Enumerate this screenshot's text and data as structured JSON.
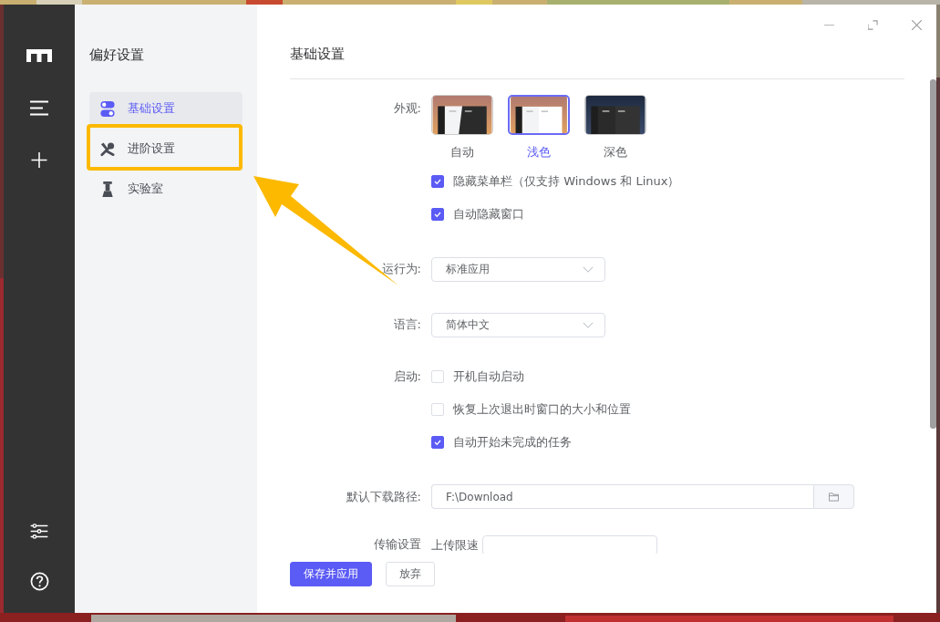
{
  "preferences": {
    "title": "偏好设置",
    "items": [
      {
        "label": "基础设置",
        "selected": true
      },
      {
        "label": "进阶设置",
        "selected": false
      },
      {
        "label": "实验室",
        "selected": false
      }
    ]
  },
  "page_title": "基础设置",
  "appearance": {
    "label": "外观:",
    "themes": [
      {
        "label": "自动",
        "kind": "auto",
        "selected": false
      },
      {
        "label": "浅色",
        "kind": "light",
        "selected": true
      },
      {
        "label": "深色",
        "kind": "dark",
        "selected": false
      }
    ],
    "options": [
      {
        "label": "隐藏菜单栏（仅支持 Windows 和 Linux）",
        "checked": true
      },
      {
        "label": "自动隐藏窗口",
        "checked": true
      }
    ]
  },
  "run_as": {
    "label": "运行为:",
    "value": "标准应用"
  },
  "language": {
    "label": "语言:",
    "value": "简体中文"
  },
  "startup": {
    "label": "启动:",
    "options": [
      {
        "label": "开机自动启动",
        "checked": false
      },
      {
        "label": "恢复上次退出时窗口的大小和位置",
        "checked": false
      },
      {
        "label": "自动开始未完成的任务",
        "checked": true
      }
    ]
  },
  "download_path": {
    "label": "默认下载路径:",
    "value": "F:\\Download"
  },
  "transfer": {
    "label": "传输设置",
    "sublabel": "上传限速"
  },
  "buttons": [
    {
      "label": "保存并应用",
      "kind": "primary"
    },
    {
      "label": "放弃",
      "kind": "plain"
    }
  ]
}
